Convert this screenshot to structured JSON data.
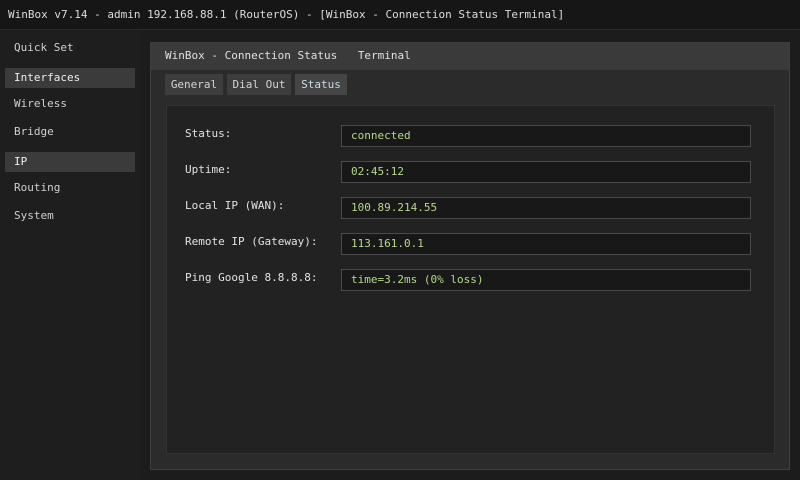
{
  "window": {
    "title": "WinBox v7.14 - admin 192.168.88.1 (RouterOS) - [WinBox - Connection Status   Terminal]"
  },
  "sidebar": {
    "items": [
      {
        "label": "Quick Set",
        "active": false
      },
      {
        "label": "Interfaces",
        "active": true
      },
      {
        "label": "Wireless",
        "active": false
      },
      {
        "label": "Bridge",
        "active": false
      },
      {
        "label": "IP",
        "active": true
      },
      {
        "label": "Routing",
        "active": false
      },
      {
        "label": "System",
        "active": false
      }
    ]
  },
  "panel": {
    "header": {
      "title": "WinBox - Connection Status",
      "terminal": "Terminal"
    },
    "tabs": [
      {
        "label": "General",
        "active": false
      },
      {
        "label": "Dial Out",
        "active": false
      },
      {
        "label": "Status",
        "active": true
      }
    ],
    "rows": [
      {
        "label": "Status:",
        "value": "connected"
      },
      {
        "label": "Uptime:",
        "value": "02:45:12"
      },
      {
        "label": "Local IP (WAN):",
        "value": "100.89.214.55"
      },
      {
        "label": "Remote IP (Gateway):",
        "value": "113.161.0.1"
      },
      {
        "label": "Ping Google 8.8.8.8:",
        "value": "time=3.2ms (0% loss)"
      }
    ]
  },
  "colors": {
    "value_text": "#b5d98a",
    "active_tab_text": "#c7dde8",
    "highlight": "#3b3b3b"
  }
}
